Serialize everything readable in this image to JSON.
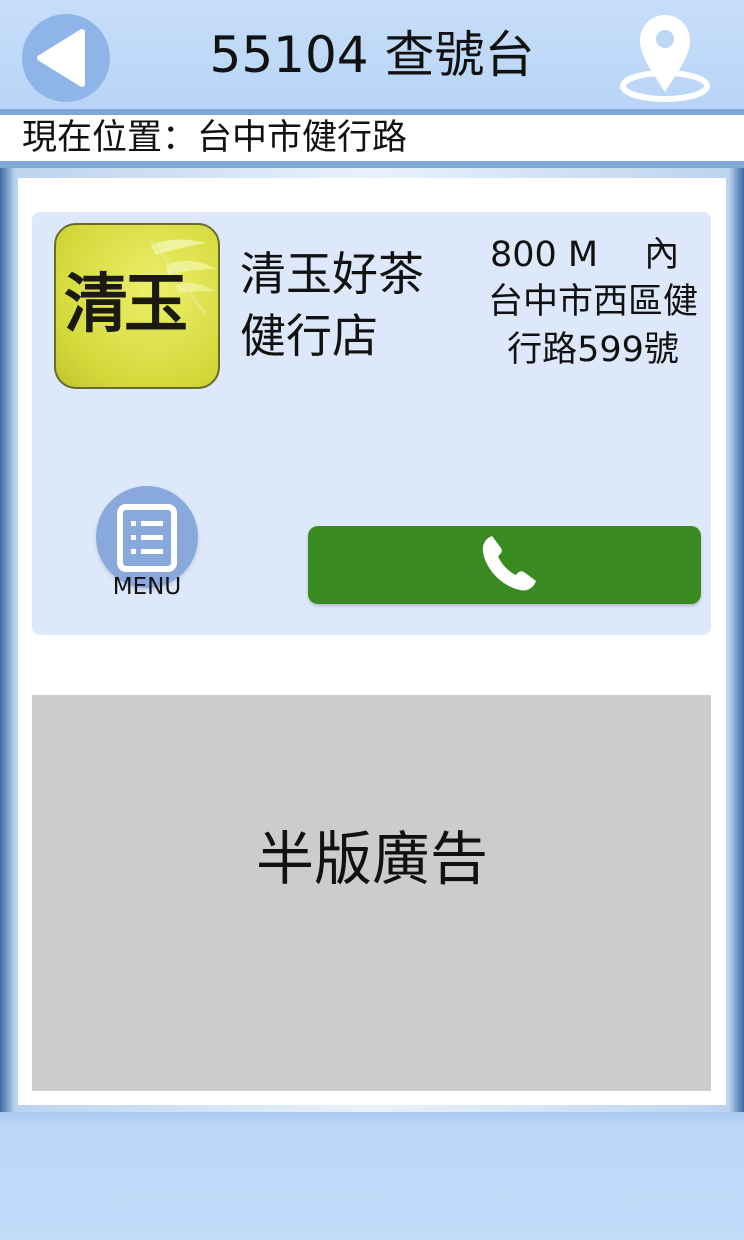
{
  "header": {
    "title": "55104 查號台",
    "back_icon": "back-arrow-icon",
    "location_icon": "map-pin-icon"
  },
  "location": {
    "text": "現在位置：台中市健行路"
  },
  "store": {
    "logo_text": "清玉",
    "name": "清玉好茶健行店",
    "distance": "800 M　 內",
    "address": "台中市西區健行路599號"
  },
  "actions": {
    "menu_label": "MENU",
    "menu_icon": "list-icon",
    "call_icon": "phone-icon"
  },
  "ad": {
    "text": "半版廣告"
  },
  "colors": {
    "header_bg": "#c7defa",
    "card_bg": "#dde9fb",
    "call_button": "#3a8a22",
    "menu_button": "#89a9dc",
    "ad_bg": "#cccccc"
  }
}
